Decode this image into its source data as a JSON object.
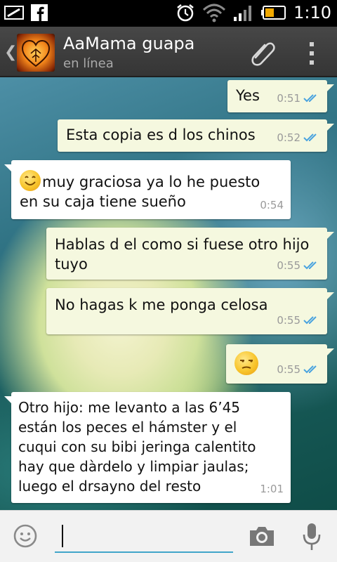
{
  "status_bar": {
    "time": "1:10",
    "left_icons": [
      "notification-icon",
      "facebook-icon"
    ],
    "right_icons": [
      "alarm-icon",
      "wifi-icon",
      "signal-icon",
      "battery-icon"
    ]
  },
  "header": {
    "contact_name": "AaMama guapa",
    "status": "en línea",
    "actions": [
      "attach-icon",
      "overflow-menu-icon"
    ]
  },
  "messages": [
    {
      "dir": "out",
      "text": "Yes",
      "time": "0:51",
      "read": true
    },
    {
      "dir": "out",
      "text": "Esta copia es d los chinos",
      "time": "0:52",
      "read": true
    },
    {
      "dir": "in",
      "emoji": "smiling-face-emoji",
      "text1": "muy graciosa ya lo he puesto",
      "text2": "en su caja tiene sueño",
      "time": "0:54"
    },
    {
      "dir": "out",
      "text1": "Hablas d el como si fuese otro hijo",
      "text2": "tuyo",
      "time": "0:55",
      "read": true
    },
    {
      "dir": "out",
      "text": "No hagas k me ponga celosa",
      "time": "0:55",
      "read": true
    },
    {
      "dir": "out",
      "emoji": "unamused-face-emoji",
      "time": "0:55",
      "read": true
    },
    {
      "dir": "in",
      "lines": [
        "Otro hijo: me levanto a las 6’45",
        "están los peces el hámster y el",
        "cuqui con su bibi jeringa calentito",
        "hay que dàrdelo y limpiar jaulas;",
        "luego el drsayno  del resto"
      ],
      "time": "1:01"
    }
  ],
  "composer": {
    "value": "",
    "icons": [
      "emoji-icon",
      "camera-icon",
      "microphone-icon"
    ]
  },
  "colors": {
    "outgoing_bubble": "#f5f8df",
    "incoming_bubble": "#ffffff",
    "read_ticks": "#4aa3df",
    "action_bar": "#3a3a3a"
  }
}
